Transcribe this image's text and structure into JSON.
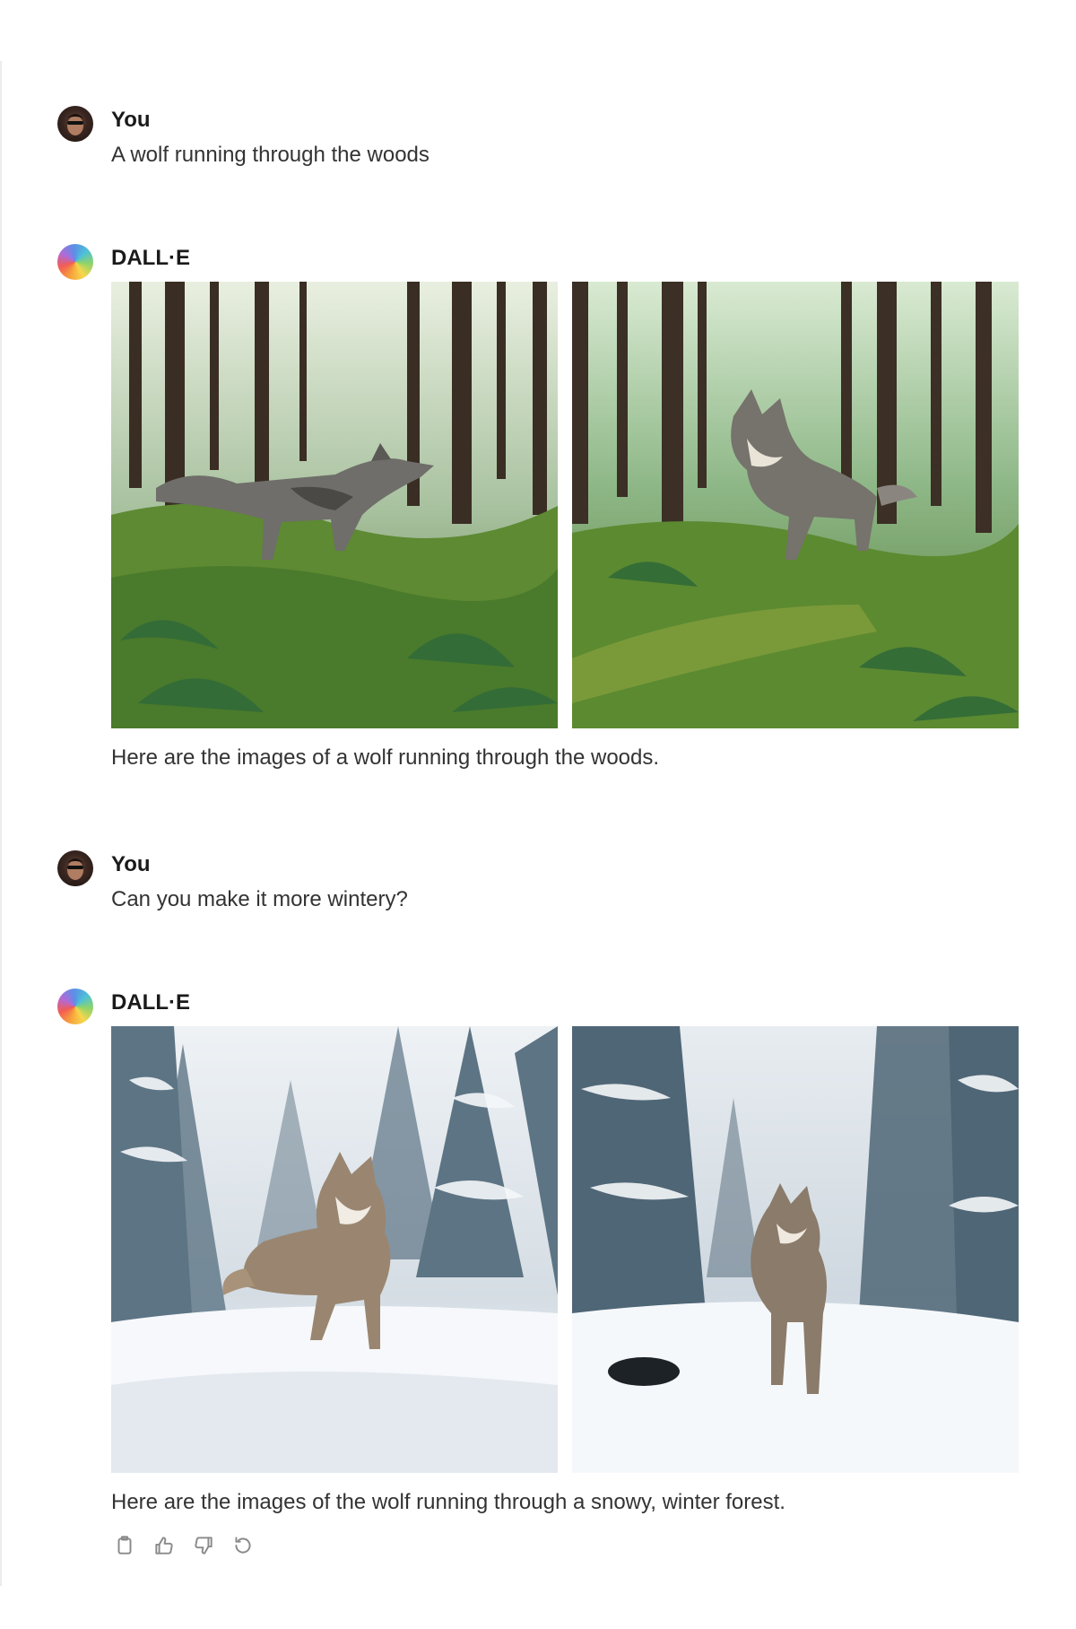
{
  "conversation": [
    {
      "author": "You",
      "text": "A wolf running through the woods"
    },
    {
      "author": "DALL·E",
      "text": "Here are the images of a wolf running through the woods."
    },
    {
      "author": "You",
      "text": "Can you make it more wintery?"
    },
    {
      "author": "DALL·E",
      "text": "Here are the images of the wolf running through a snowy, winter forest."
    }
  ],
  "actions": [
    "copy-icon",
    "thumbs-up-icon",
    "thumbs-down-icon",
    "regenerate-icon"
  ]
}
